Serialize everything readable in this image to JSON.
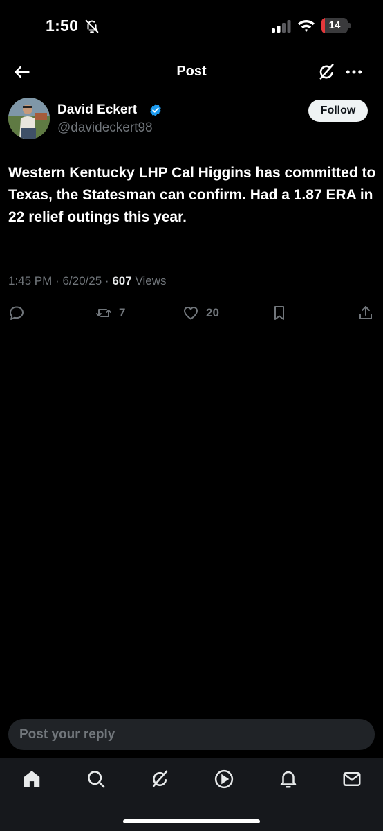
{
  "status_bar": {
    "time": "1:50",
    "battery_level": "14",
    "battery_fraction": 0.14,
    "icons": [
      "bell-off-icon",
      "signal-icon",
      "wifi-icon",
      "battery-icon"
    ]
  },
  "header": {
    "title": "Post",
    "icons": [
      "back-arrow-icon",
      "grok-icon",
      "more-icon"
    ]
  },
  "post": {
    "author_name": "David Eckert",
    "author_handle": "@davideckert98",
    "follow_label": "Follow",
    "text": "Western Kentucky LHP Cal Higgins has committed to Texas, the Statesman can confirm. Had a 1.87 ERA in 22 relief outings this year.",
    "time": "1:45 PM",
    "date": "6/20/25",
    "views_count": "607",
    "views_label": "Views",
    "sep": "·"
  },
  "actions": {
    "reposts": "7",
    "likes": "20",
    "icons": [
      "reply-icon",
      "repost-icon",
      "like-icon",
      "bookmark-icon",
      "share-icon"
    ]
  },
  "reply": {
    "placeholder": "Post your reply"
  },
  "tabbar": {
    "items": [
      "home-icon",
      "search-icon",
      "grok-icon",
      "video-icon",
      "notifications-icon",
      "messages-icon"
    ]
  },
  "colors": {
    "background": "#000000",
    "primary_text": "#e7e9ea",
    "secondary_text": "#71767b",
    "verified_blue": "#1d9bf0",
    "battery_low": "#e5383b"
  }
}
